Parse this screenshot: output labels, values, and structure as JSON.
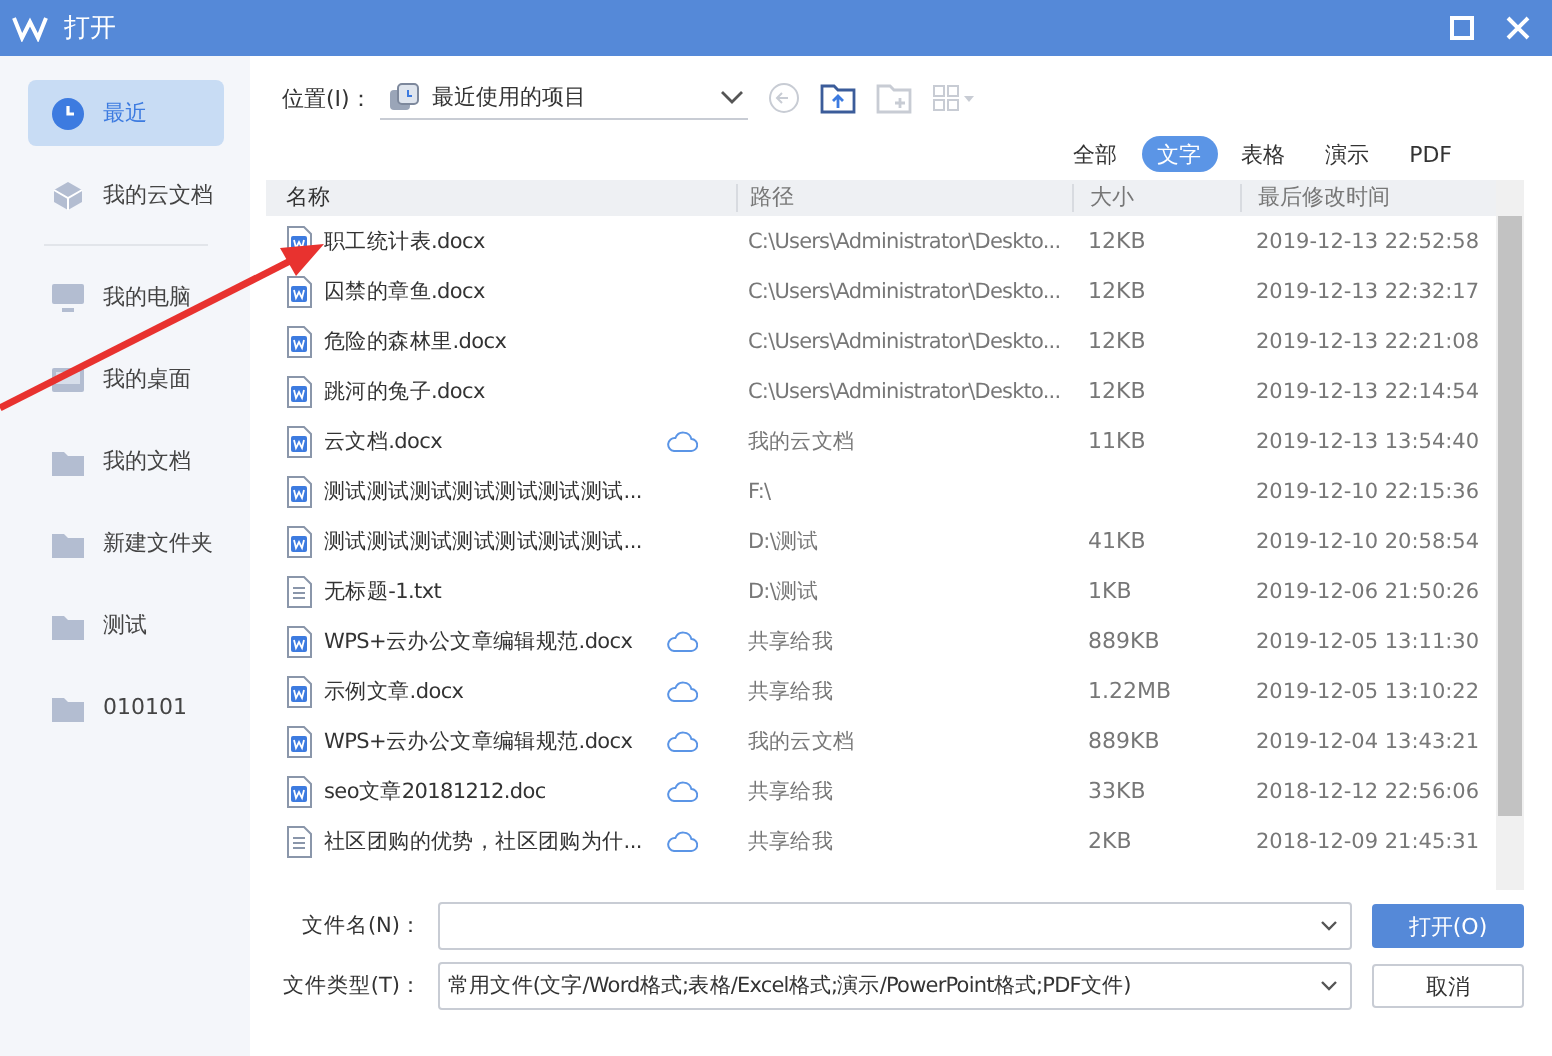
{
  "window": {
    "title": "打开"
  },
  "sidebar": {
    "items": [
      {
        "label": "最近",
        "selected": true
      },
      {
        "label": "我的云文档",
        "selected": false
      },
      {
        "label": "我的电脑",
        "selected": false
      },
      {
        "label": "我的桌面",
        "selected": false
      },
      {
        "label": "我的文档",
        "selected": false
      },
      {
        "label": "新建文件夹",
        "selected": false
      },
      {
        "label": "测试",
        "selected": false
      },
      {
        "label": "010101",
        "selected": false
      }
    ]
  },
  "location": {
    "label": "位置(I)：",
    "value": "最近使用的项目"
  },
  "filters": [
    {
      "label": "全部",
      "selected": false
    },
    {
      "label": "文字",
      "selected": true
    },
    {
      "label": "表格",
      "selected": false
    },
    {
      "label": "演示",
      "selected": false
    },
    {
      "label": "PDF",
      "selected": false
    }
  ],
  "table": {
    "columns": [
      "名称",
      "路径",
      "大小",
      "最后修改时间"
    ],
    "rows": [
      {
        "kind": "doc",
        "name": "职工统计表.docx",
        "cloud": false,
        "path": "C:\\Users\\Administrator\\Deskto...",
        "size": "12KB",
        "modified": "2019-12-13 22:52:58"
      },
      {
        "kind": "doc",
        "name": "囚禁的章鱼.docx",
        "cloud": false,
        "path": "C:\\Users\\Administrator\\Deskto...",
        "size": "12KB",
        "modified": "2019-12-13 22:32:17"
      },
      {
        "kind": "doc",
        "name": "危险的森林里.docx",
        "cloud": false,
        "path": "C:\\Users\\Administrator\\Deskto...",
        "size": "12KB",
        "modified": "2019-12-13 22:21:08"
      },
      {
        "kind": "doc",
        "name": "跳河的兔子.docx",
        "cloud": false,
        "path": "C:\\Users\\Administrator\\Deskto...",
        "size": "12KB",
        "modified": "2019-12-13 22:14:54"
      },
      {
        "kind": "doc",
        "name": "云文档.docx",
        "cloud": true,
        "path": "我的云文档",
        "size": "11KB",
        "modified": "2019-12-13 13:54:40"
      },
      {
        "kind": "doc",
        "name": "测试测试测试测试测试测试测试...",
        "cloud": false,
        "path": "F:\\",
        "modified": "2019-12-10 22:15:36"
      },
      {
        "kind": "doc",
        "name": "测试测试测试测试测试测试测试...",
        "cloud": false,
        "path": "D:\\测试",
        "size": "41KB",
        "modified": "2019-12-10 20:58:54"
      },
      {
        "kind": "txt",
        "name": "无标题-1.txt",
        "cloud": false,
        "path": "D:\\测试",
        "size": "1KB",
        "modified": "2019-12-06 21:50:26"
      },
      {
        "kind": "doc",
        "name": "WPS+云办公文章编辑规范.docx",
        "cloud": true,
        "path": "共享给我",
        "size": "889KB",
        "modified": "2019-12-05 13:11:30"
      },
      {
        "kind": "doc",
        "name": "示例文章.docx",
        "cloud": true,
        "path": "共享给我",
        "size": "1.22MB",
        "modified": "2019-12-05 13:10:22"
      },
      {
        "kind": "doc",
        "name": "WPS+云办公文章编辑规范.docx",
        "cloud": true,
        "path": "我的云文档",
        "size": "889KB",
        "modified": "2019-12-04 13:43:21"
      },
      {
        "kind": "doc",
        "name": "seo文章20181212.doc",
        "cloud": true,
        "path": "共享给我",
        "size": "33KB",
        "modified": "2018-12-12 22:56:06"
      },
      {
        "kind": "txt",
        "name": "社区团购的优势，社区团购为什...",
        "cloud": true,
        "path": "共享给我",
        "size": "2KB",
        "modified": "2018-12-09 21:45:31"
      }
    ]
  },
  "filename": {
    "label": "文件名(N)："
  },
  "filetype": {
    "label": "文件类型(T)：",
    "value": "常用文件(文字/Word格式;表格/Excel格式;演示/PowerPoint格式;PDF文件)"
  },
  "buttons": [
    {
      "label": "打开(O)",
      "kind": "primary"
    },
    {
      "label": "取消",
      "kind": "normal"
    }
  ]
}
